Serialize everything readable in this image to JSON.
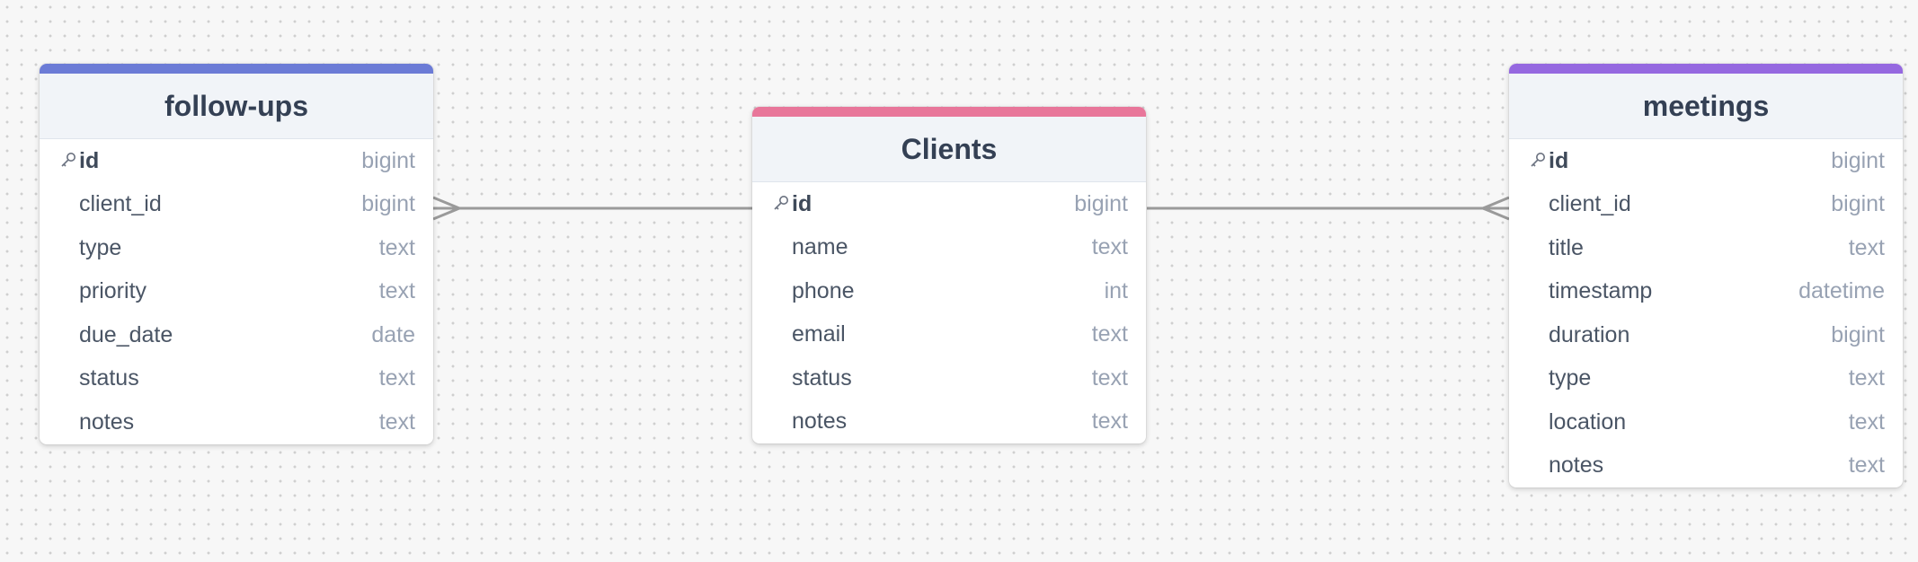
{
  "tables": [
    {
      "id": "follow-ups",
      "name": "follow-ups",
      "accent": "#6b7bd6",
      "fields": [
        {
          "name": "id",
          "type": "bigint",
          "pk": true
        },
        {
          "name": "client_id",
          "type": "bigint",
          "pk": false
        },
        {
          "name": "type",
          "type": "text",
          "pk": false
        },
        {
          "name": "priority",
          "type": "text",
          "pk": false
        },
        {
          "name": "due_date",
          "type": "date",
          "pk": false
        },
        {
          "name": "status",
          "type": "text",
          "pk": false
        },
        {
          "name": "notes",
          "type": "text",
          "pk": false
        }
      ]
    },
    {
      "id": "clients",
      "name": "Clients",
      "accent": "#e8769a",
      "fields": [
        {
          "name": "id",
          "type": "bigint",
          "pk": true
        },
        {
          "name": "name",
          "type": "text",
          "pk": false
        },
        {
          "name": "phone",
          "type": "int",
          "pk": false
        },
        {
          "name": "email",
          "type": "text",
          "pk": false
        },
        {
          "name": "status",
          "type": "text",
          "pk": false
        },
        {
          "name": "notes",
          "type": "text",
          "pk": false
        }
      ]
    },
    {
      "id": "meetings",
      "name": "meetings",
      "accent": "#9568e0",
      "fields": [
        {
          "name": "id",
          "type": "bigint",
          "pk": true
        },
        {
          "name": "client_id",
          "type": "bigint",
          "pk": false
        },
        {
          "name": "title",
          "type": "text",
          "pk": false
        },
        {
          "name": "timestamp",
          "type": "datetime",
          "pk": false
        },
        {
          "name": "duration",
          "type": "bigint",
          "pk": false
        },
        {
          "name": "type",
          "type": "text",
          "pk": false
        },
        {
          "name": "location",
          "type": "text",
          "pk": false
        },
        {
          "name": "notes",
          "type": "text",
          "pk": false
        }
      ]
    }
  ],
  "relationships": [
    {
      "from": "clients.id",
      "to": "follow-ups.client_id",
      "to_cardinality": "many"
    },
    {
      "from": "clients.id",
      "to": "meetings.client_id",
      "to_cardinality": "many"
    }
  ],
  "colors": {
    "connector": "#9a9a9a",
    "key_icon": "#6b7280"
  },
  "icons": {
    "primary_key": "key-icon"
  }
}
